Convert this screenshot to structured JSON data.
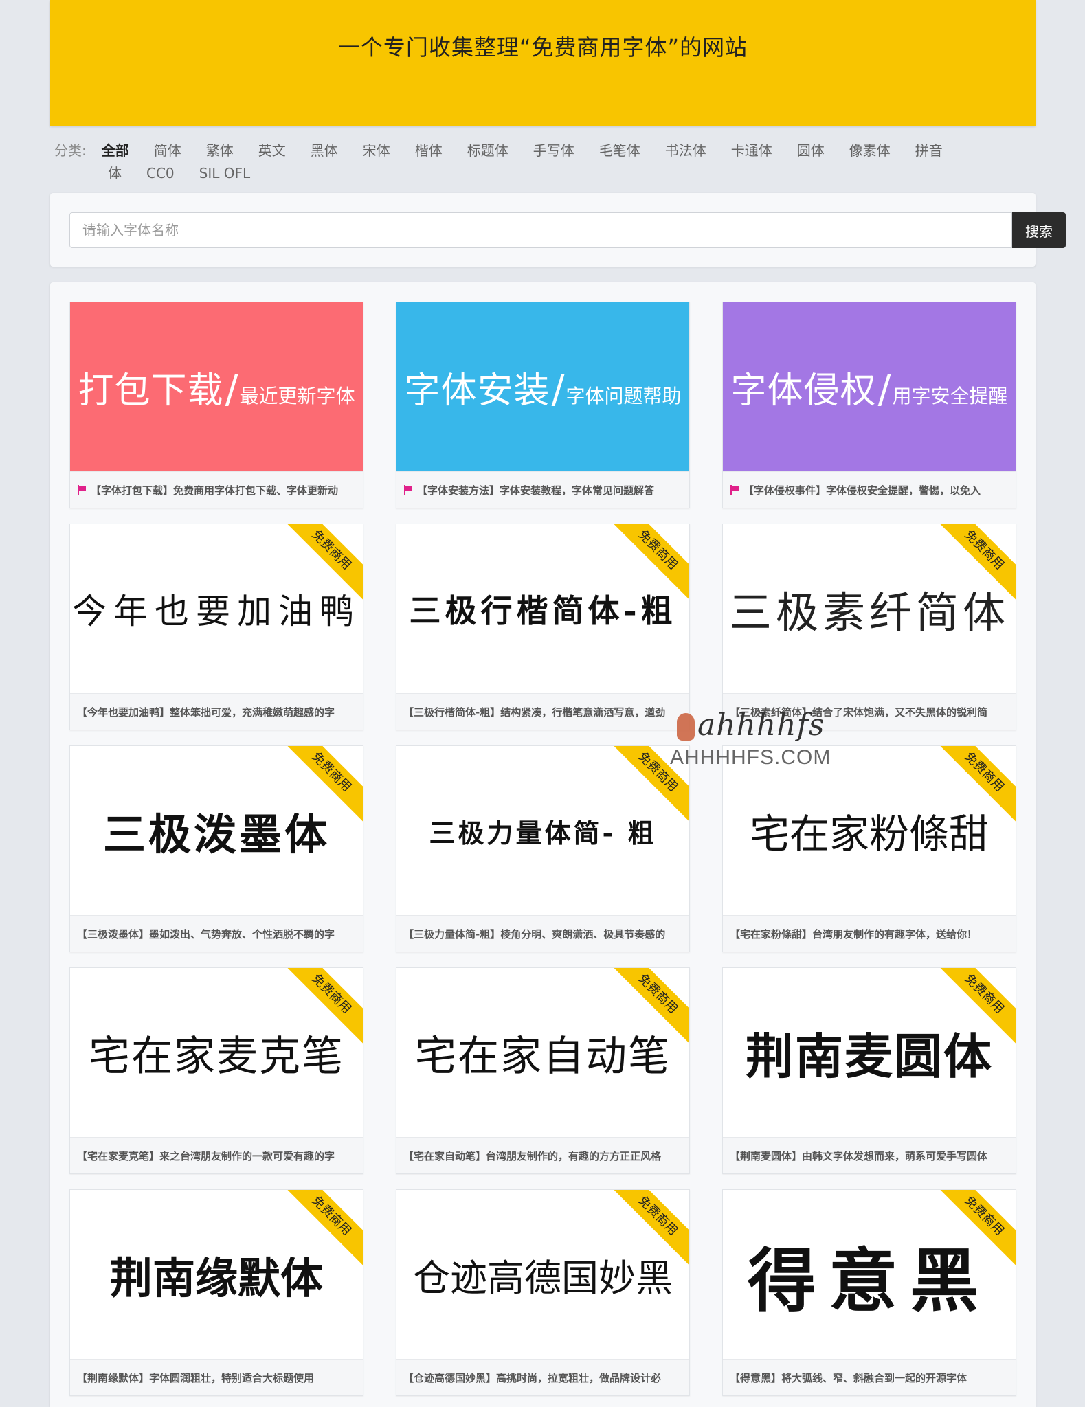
{
  "banner": {
    "title": "一个专门收集整理“免费商用字体”的网站"
  },
  "categories": {
    "label": "分类:",
    "line1": [
      "全部",
      "简体",
      "繁体",
      "英文",
      "黑体",
      "宋体",
      "楷体",
      "标题体",
      "手写体",
      "毛笔体",
      "书法体",
      "卡通体",
      "圆体",
      "像素体",
      "拼音"
    ],
    "line2": [
      "体",
      "CC0",
      "SIL OFL"
    ],
    "active": "全部"
  },
  "search": {
    "placeholder": "请输入字体名称",
    "button_label": "搜索"
  },
  "badge_label": "免费商用",
  "promo_cards": [
    {
      "main": "打包下载",
      "slash": "/",
      "sub": "最近更新字体",
      "color": "#fc6b73",
      "caption": "【字体打包下载】免费商用字体打包下载、字体更新动"
    },
    {
      "main": "字体安装",
      "slash": "/",
      "sub": "字体问题帮助",
      "color": "#38b7ea",
      "caption": "【字体安装方法】字体安装教程，字体常见问题解答"
    },
    {
      "main": "字体侵权",
      "slash": "/",
      "sub": "用字安全提醒",
      "color": "#a377e4",
      "caption": "【字体侵权事件】字体侵权安全提醒，警惕，以免入"
    }
  ],
  "font_cards": [
    {
      "sample": "今年也要加油鸭",
      "caption": "【今年也要加油鸭】整体笨拙可爱，充满稚嫩萌趣感的字"
    },
    {
      "sample": "三极行楷简体-粗",
      "caption": "【三极行楷简体-粗】结构紧凑，行楷笔意潇洒写意，遒劲"
    },
    {
      "sample": "三极素纤简体",
      "caption": "【三极素纤简体】结合了宋体饱满，又不失黑体的锐利简"
    },
    {
      "sample": "三极泼墨体",
      "caption": "【三极泼墨体】墨如泼出、气势奔放、个性洒脱不羁的字"
    },
    {
      "sample": "三极力量体简- 粗",
      "caption": "【三极力量体简-粗】棱角分明、爽朗潇洒、极具节奏感的"
    },
    {
      "sample": "宅在家粉條甜",
      "caption": "【宅在家粉條甜】台湾朋友制作的有趣字体，送给你！"
    },
    {
      "sample": "宅在家麦克笔",
      "caption": "【宅在家麦克笔】来之台湾朋友制作的一款可爱有趣的字"
    },
    {
      "sample": "宅在家自动笔",
      "caption": "【宅在家自动笔】台湾朋友制作的，有趣的方方正正风格"
    },
    {
      "sample": "荆南麦圆体",
      "caption": "【荆南麦圆体】由韩文字体发想而来，萌系可爱手写圆体"
    },
    {
      "sample": "荆南缘默体",
      "caption": "【荆南缘默体】字体圆润粗壮，特别适合大标题使用"
    },
    {
      "sample": "仓迹高德国妙黑",
      "caption": "【仓迹高德国妙黑】高挑时尚，拉宽粗壮，做品牌设计必"
    },
    {
      "sample": "得意黑",
      "caption": "【得意黑】将大弧线、窄、斜融合到一起的开源字体"
    }
  ],
  "watermark": {
    "script": "ahhhhfs",
    "domain": "AHHHHFS.COM"
  }
}
